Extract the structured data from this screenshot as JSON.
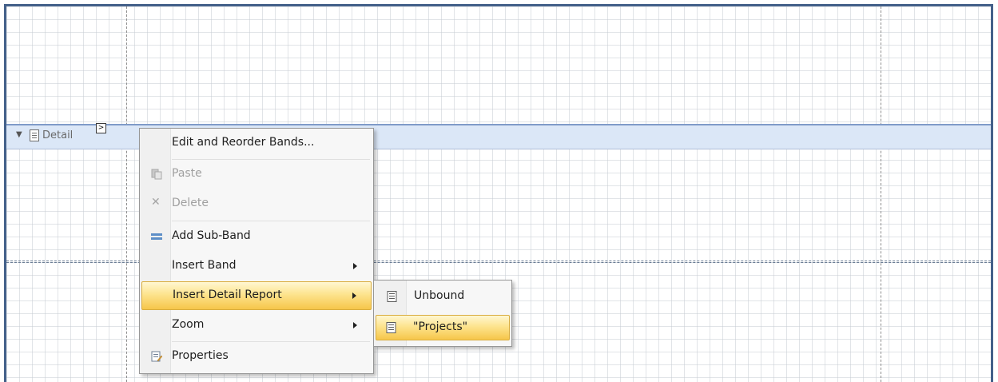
{
  "band": {
    "label": "Detail",
    "smart_tag": ">"
  },
  "context_menu": {
    "items": [
      {
        "label": "Edit and Reorder Bands...",
        "icon": ""
      },
      {
        "label": "Paste",
        "icon": "paste-icon",
        "disabled": true
      },
      {
        "label": "Delete",
        "icon": "delete-icon",
        "disabled": true
      },
      {
        "label": "Add Sub-Band",
        "icon": "sub-band-icon"
      },
      {
        "label": "Insert Band",
        "icon": "",
        "submenu": true
      },
      {
        "label": "Insert Detail Report",
        "icon": "",
        "submenu": true,
        "highlighted": true
      },
      {
        "label": "Zoom",
        "icon": "",
        "submenu": true
      },
      {
        "label": "Properties",
        "icon": "properties-icon"
      }
    ]
  },
  "submenu": {
    "items": [
      {
        "label": "Unbound",
        "icon": "report-icon"
      },
      {
        "label": "\"Projects\"",
        "icon": "report-icon",
        "highlighted": true
      }
    ]
  },
  "colors": {
    "highlight": "#f6c64a",
    "band_header": "#dbe7f7",
    "frame": "#44618a"
  }
}
